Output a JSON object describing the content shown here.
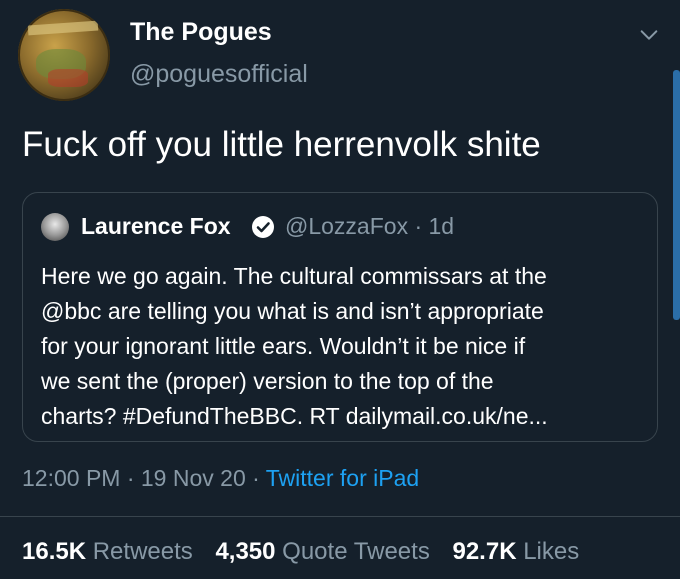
{
  "tweet": {
    "display_name": "The Pogues",
    "handle": "@poguesofficial",
    "text": "Fuck off you little herrenvolk shite",
    "timestamp": "12:00 PM · 19 Nov 20 · ",
    "source": "Twitter for iPad",
    "avatar_icon": "band-album-art-avatar"
  },
  "quoted_tweet": {
    "display_name": "Laurence Fox",
    "verified": true,
    "handle_and_time": "@LozzaFox · 1d",
    "lines": [
      "Here we go again. The cultural commissars at the",
      "@bbc are telling you what is and isn’t appropriate",
      "for your ignorant little ears. Wouldn’t it be nice if",
      "we sent the (proper) version to the top of the",
      "charts? #DefundTheBBC. RT dailymail.co.uk/ne..."
    ]
  },
  "stats": {
    "retweets_count": "16.5K",
    "retweets_label": " Retweets",
    "quote_count": "4,350",
    "quote_label": " Quote Tweets",
    "likes_count": "92.7K",
    "likes_label": " Likes"
  },
  "colors": {
    "background": "#15202b",
    "secondary_text": "#8899a6",
    "accent": "#1da1f2",
    "border": "#38444d"
  }
}
